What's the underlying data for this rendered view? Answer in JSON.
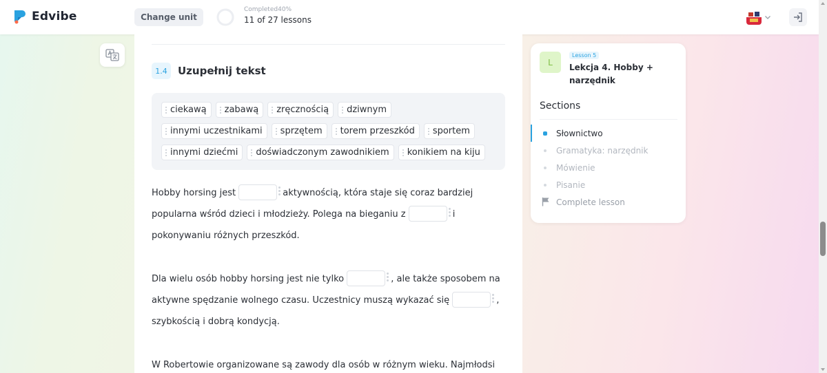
{
  "app": {
    "name": "Edvibe"
  },
  "header": {
    "change_unit_label": "Change unit",
    "progress_label": "Completed40%",
    "progress_percent": 40,
    "lessons_count": "11 of 27 lessons"
  },
  "exercise": {
    "number": "1.4",
    "title": "Uzupełnij tekst",
    "word_bank": [
      "ciekawą",
      "zabawą",
      "zręcznością",
      "dziwnym",
      "innymi uczestnikami",
      "sprzętem",
      "torem przeszkód",
      "sportem",
      "innymi dziećmi",
      "doświadczonym zawodnikiem",
      "konikiem na kiju"
    ],
    "p1": {
      "a": "Hobby horsing jest",
      "b": "aktywnością, która staje się coraz bardziej popularna wśród dzieci i młodzieży. Polega na bieganiu z",
      "c": "i pokonywaniu różnych przeszkód."
    },
    "p2": {
      "a": "Dla wielu osób hobby horsing jest nie tylko",
      "b": ", ale także sposobem na aktywne spędzanie wolnego czasu. Uczestnicy muszą wykazać się",
      "c": ", szybkością i dobrą kondycją."
    },
    "p3": {
      "a": "W Robertowie organizowane są zawody dla osób w różnym wieku. Najmłodsi"
    }
  },
  "sidebar": {
    "lesson_badge": "L",
    "lesson_tag": "Lesson 5",
    "lesson_name": "Lekcja 4. Hobby + narzędnik",
    "sections_title": "Sections",
    "sections": [
      {
        "label": "Słownictwo",
        "active": true
      },
      {
        "label": "Gramatyka: narzędnik",
        "active": false
      },
      {
        "label": "Mówienie",
        "active": false
      },
      {
        "label": "Pisanie",
        "active": false
      }
    ],
    "complete_label": "Complete lesson"
  },
  "colors": {
    "accent": "#2aa2e0",
    "lesson_badge_bg": "#dff5c9",
    "lesson_badge_fg": "#7fbf44"
  },
  "icons": {
    "logo": "edvibe-logo-icon",
    "translate": "translate-icon",
    "avatar": "flag-avatar-icon",
    "chevron": "chevron-down-icon",
    "logout": "logout-icon",
    "flag": "flag-icon"
  }
}
